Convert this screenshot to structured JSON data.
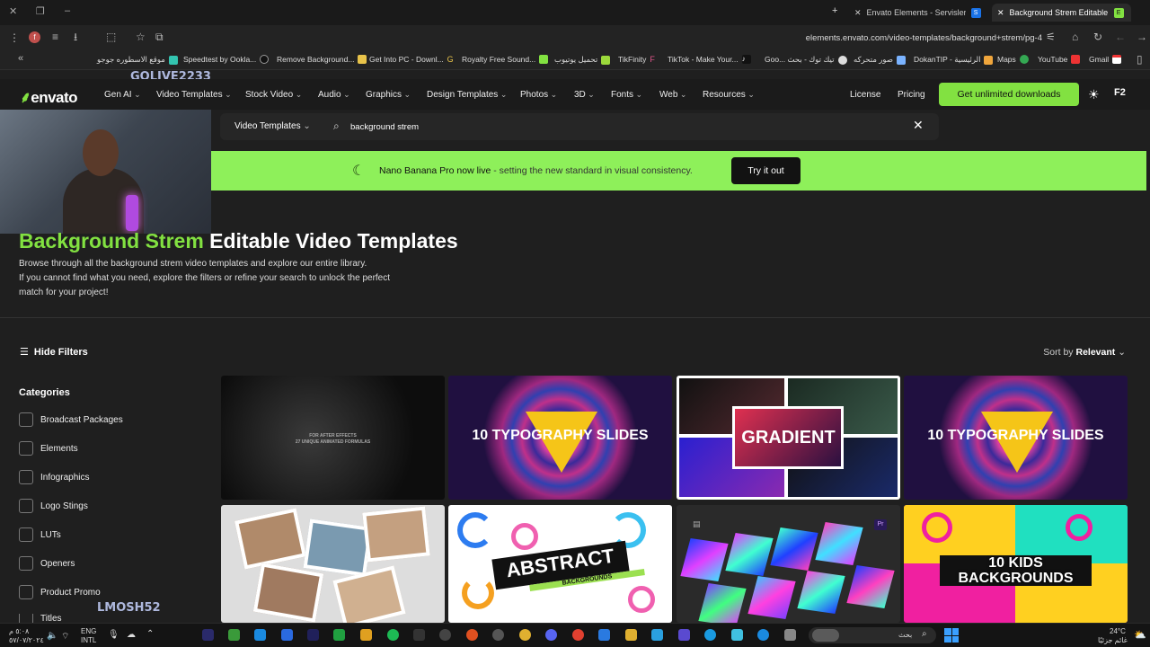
{
  "browser": {
    "tabs": [
      {
        "title": "Envato Elements - Servisler - St...",
        "favicon": "S"
      },
      {
        "title": "Background Strem Editable Vid...",
        "favicon": "E"
      }
    ],
    "new_tab": "+",
    "url": "elements.envato.com/video-templates/background+strem/pg-4",
    "bookmarks": [
      "موقع الاسطوره جوجو",
      "Speedtest by Ookla...",
      "Remove Background...",
      "Get Into PC - Downl...",
      "Royalty Free Sound...",
      "تحميل يوتيوب",
      "TikFinity",
      "TikTok - Make Your...",
      "Goo... تيك توك - بحث",
      "صور متحركه",
      "DokanTIP - الرئيسية",
      "Maps",
      "YouTube",
      "Gmail"
    ]
  },
  "overlay": {
    "top": "GOLIVE2233",
    "bottom": "LMOSH52"
  },
  "nav": {
    "logo_text": "envato",
    "items": [
      "Gen AI",
      "Video Templates",
      "Stock Video",
      "Audio",
      "Graphics",
      "Design Templates",
      "Photos",
      "3D",
      "Fonts",
      "Web",
      "Resources"
    ],
    "license": "License",
    "pricing": "Pricing",
    "cta": "Get unlimited downloads",
    "avatar": "F2"
  },
  "search": {
    "category": "Video Templates",
    "query": "background strem"
  },
  "banner": {
    "title": "Nano Banana Pro now live",
    "subtitle": " - setting the new standard in visual consistency.",
    "button": "Try it out"
  },
  "hero": {
    "title_highlight": "Background Strem",
    "title_rest": " Editable Video Templates",
    "line1": "Browse through all the background strem video templates and explore our entire library.",
    "line2": "If you cannot find what you need, explore the filters or refine your search to unlock the perfect",
    "line3": "match for your project!"
  },
  "filters": {
    "hide": "Hide Filters",
    "sort_label": "Sort by",
    "sort_value": "Relevant",
    "categories_title": "Categories",
    "categories": [
      "Broadcast Packages",
      "Elements",
      "Infographics",
      "Logo Stings",
      "LUTs",
      "Openers",
      "Product Promo",
      "Titles"
    ]
  },
  "cards": [
    {
      "title": "",
      "caption": "FOR AFTER EFFECTS\n27 UNIQUE ANIMATED FORMULAS"
    },
    {
      "title": "10 TYPOGRAPHY SLIDES"
    },
    {
      "title": "GRADIENT"
    },
    {
      "title": "10 TYPOGRAPHY SLIDES"
    },
    {
      "title": ""
    },
    {
      "title": "ABSTRACT",
      "subtitle": "BACKGROUNDS"
    },
    {
      "title": "",
      "badge": "Pr"
    },
    {
      "title": "10 KIDS BACKGROUNDS"
    }
  ],
  "taskbar": {
    "lang": "ENG",
    "layout": "INTL",
    "search_placeholder": "بحث",
    "weather_temp": "24°C",
    "weather_text": "غائم جزئيًا",
    "time": "٥:٠٨ م",
    "date": "٥٧/٠٧/٢٠٢٤"
  }
}
